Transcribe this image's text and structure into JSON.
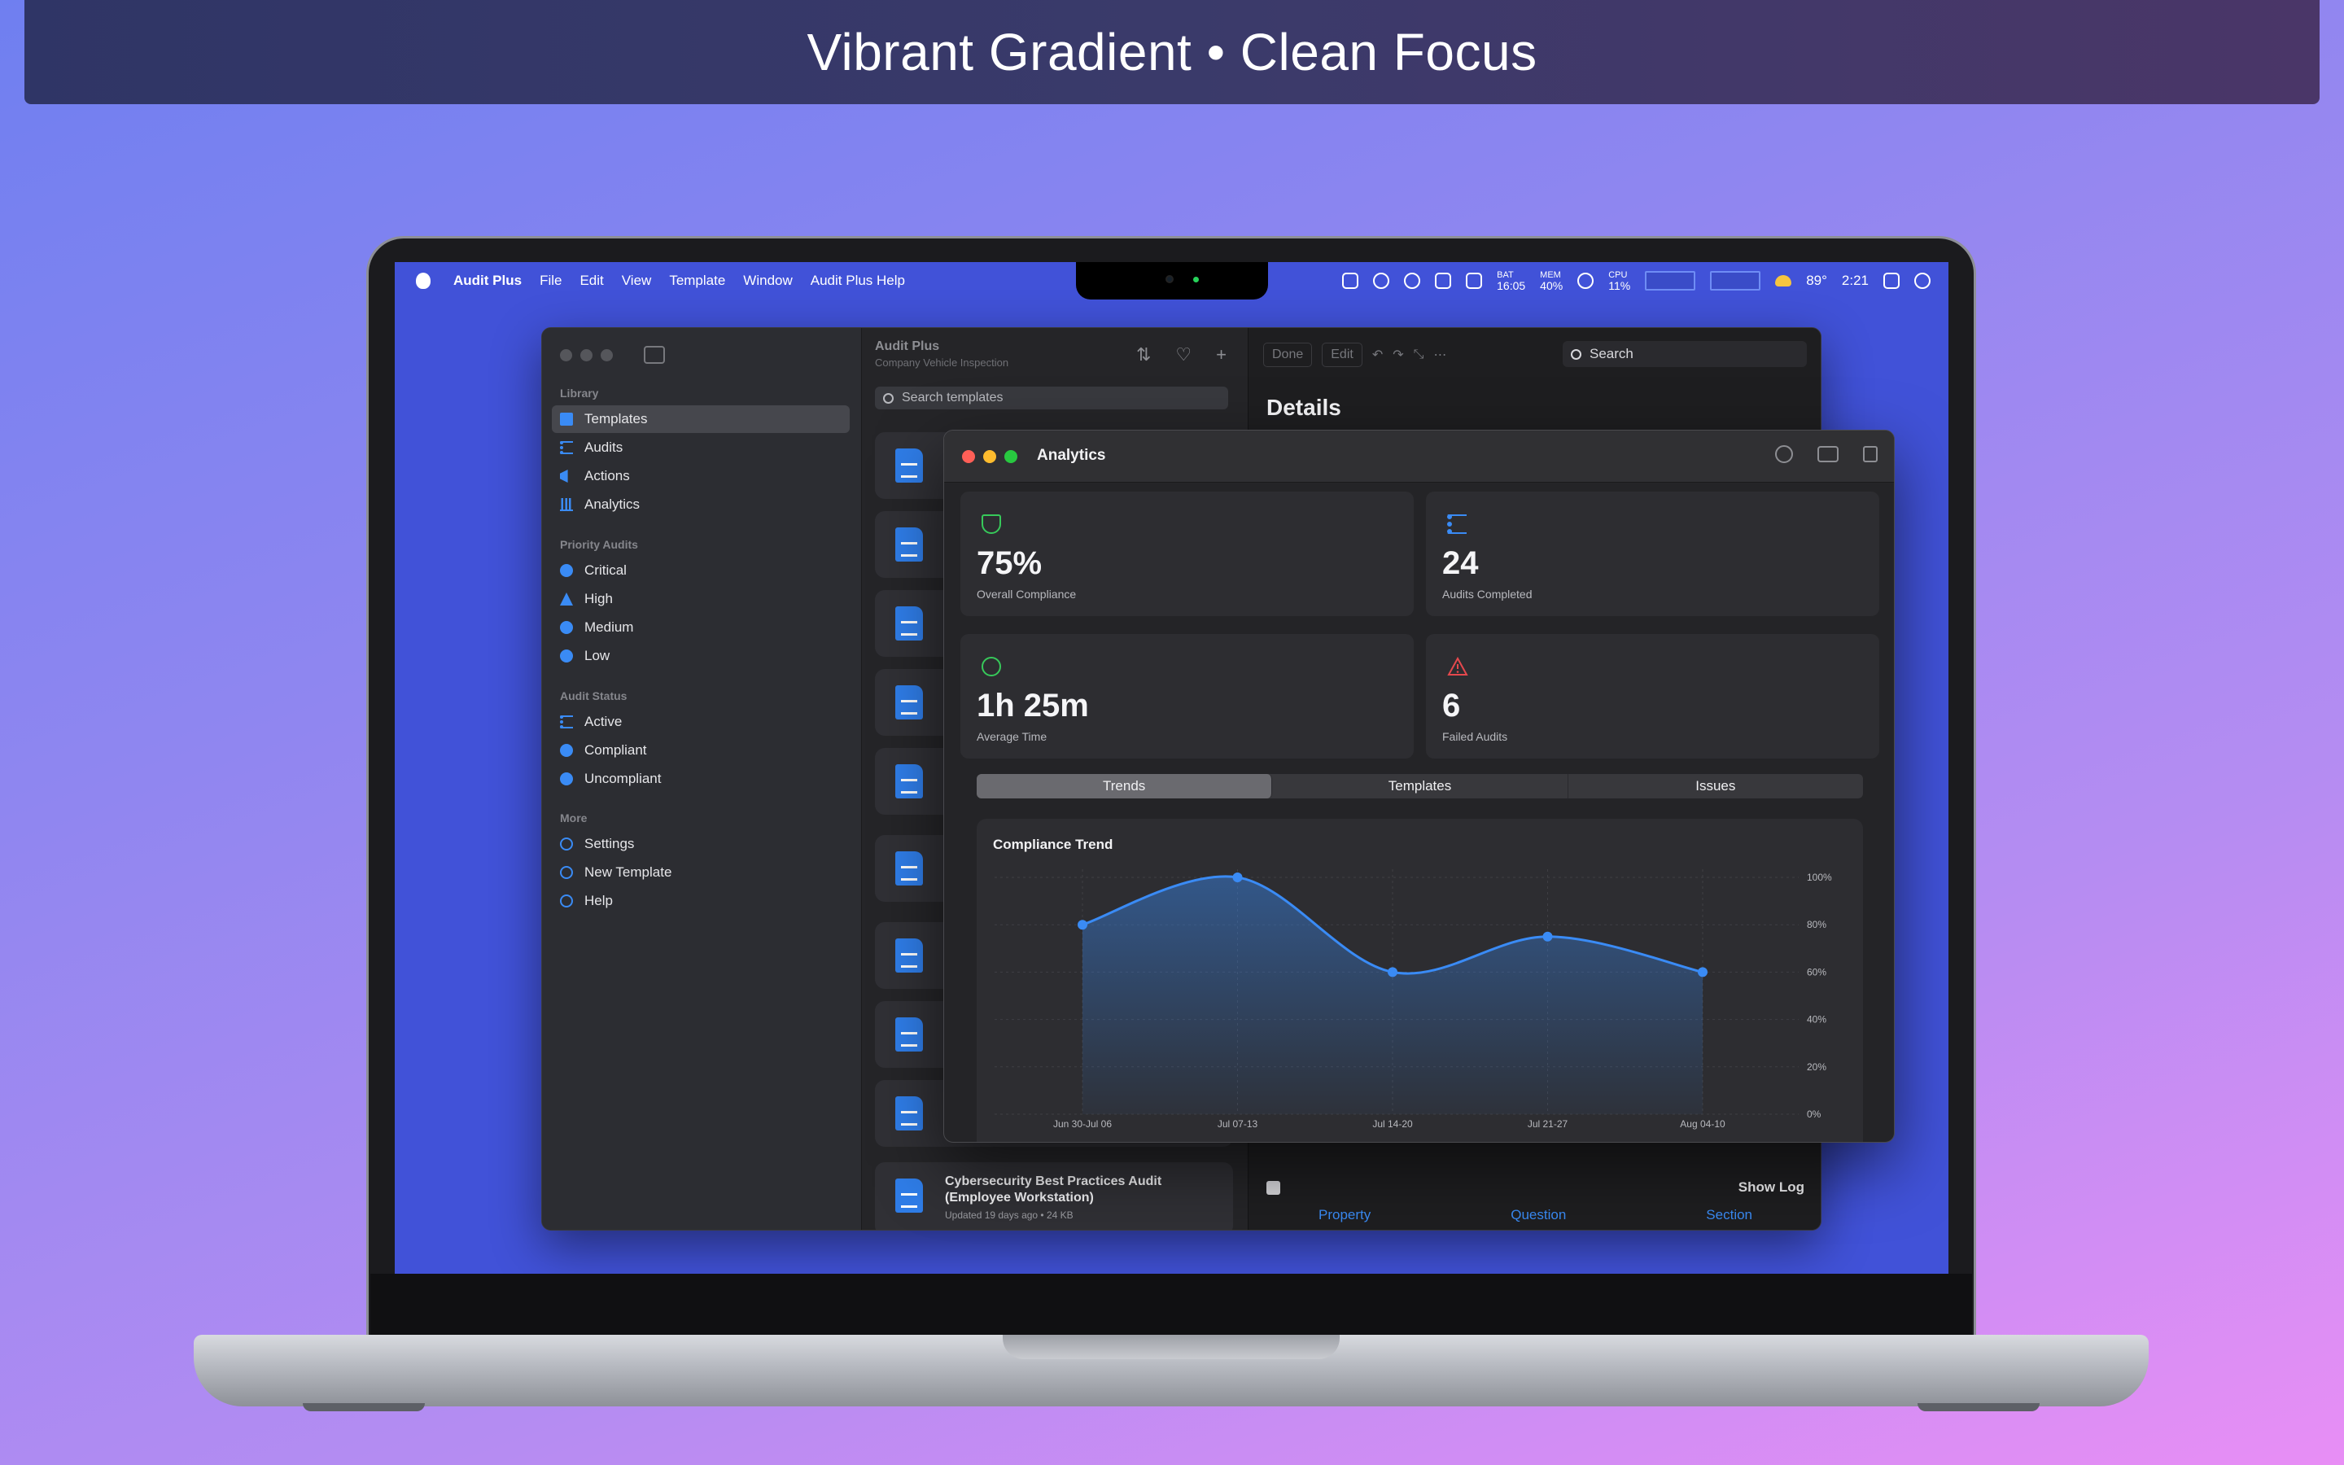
{
  "banner": {
    "title": "Vibrant Gradient • Clean Focus"
  },
  "menubar": {
    "app_name": "Audit Plus",
    "menus": [
      "File",
      "Edit",
      "View",
      "Template",
      "Window",
      "Audit Plus Help"
    ],
    "bat_label": "BAT",
    "bat_value": "16:05",
    "mem_label": "MEM",
    "mem_value": "40%",
    "cpu_label": "CPU",
    "cpu_value": "11%",
    "temperature": "89°",
    "clock": "2:21"
  },
  "sidebar": {
    "library_header": "Library",
    "library_items": [
      {
        "label": "Templates",
        "icon": "doc-icon"
      },
      {
        "label": "Audits",
        "icon": "checklist-icon"
      },
      {
        "label": "Actions",
        "icon": "megaphone-icon"
      },
      {
        "label": "Analytics",
        "icon": "chart-icon"
      }
    ],
    "priority_header": "Priority Audits",
    "priority_items": [
      {
        "label": "Critical",
        "icon": "exclamation-circle-icon"
      },
      {
        "label": "High",
        "icon": "warning-triangle-icon"
      },
      {
        "label": "Medium",
        "icon": "minus-circle-icon"
      },
      {
        "label": "Low",
        "icon": "circle-icon"
      }
    ],
    "status_header": "Audit Status",
    "status_items": [
      {
        "label": "Active",
        "icon": "checklist-icon"
      },
      {
        "label": "Compliant",
        "icon": "check-circle-icon"
      },
      {
        "label": "Uncompliant",
        "icon": "x-circle-icon"
      }
    ],
    "more_header": "More",
    "more_items": [
      {
        "label": "Settings",
        "icon": "gear-icon"
      },
      {
        "label": "New Template",
        "icon": "plus-circle-icon"
      },
      {
        "label": "Help",
        "icon": "question-circle-icon"
      }
    ]
  },
  "list": {
    "title": "Audit Plus",
    "subtitle": "Company Vehicle Inspection",
    "search_placeholder": "Search templates",
    "last_card": {
      "title": "Cybersecurity Best Practices Audit (Employee Workstation)",
      "meta": "Updated 19 days ago • 24 KB"
    }
  },
  "detail": {
    "done_label": "Done",
    "edit_label": "Edit",
    "search_label": "Search",
    "title": "Details",
    "show_log_label": "Show Log",
    "actions": [
      "Property",
      "Question",
      "Section"
    ]
  },
  "analytics": {
    "window_title": "Analytics",
    "kpis": [
      {
        "value": "75%",
        "label": "Overall Compliance",
        "icon": "shield-check-icon"
      },
      {
        "value": "24",
        "label": "Audits Completed",
        "icon": "checklist-icon"
      },
      {
        "value": "1h 25m",
        "label": "Average Time",
        "icon": "clock-icon"
      },
      {
        "value": "6",
        "label": "Failed Audits",
        "icon": "warning-triangle-icon"
      }
    ],
    "tabs": [
      "Trends",
      "Templates",
      "Issues"
    ],
    "active_tab": "Trends"
  },
  "colors": {
    "accent": "#3a8bf5",
    "success": "#37c95a",
    "danger": "#e5484d",
    "desktop": "#4152d8"
  },
  "chart_data": {
    "type": "area",
    "title": "Compliance Trend",
    "categories": [
      "Jun 30-Jul 06",
      "Jul 07-13",
      "Jul 14-20",
      "Jul 21-27",
      "Aug 04-10"
    ],
    "values": [
      80,
      100,
      60,
      75,
      60
    ],
    "ylim": [
      0,
      100
    ],
    "yticks": [
      "0%",
      "20%",
      "40%",
      "60%",
      "80%",
      "100%"
    ],
    "grid": true
  }
}
